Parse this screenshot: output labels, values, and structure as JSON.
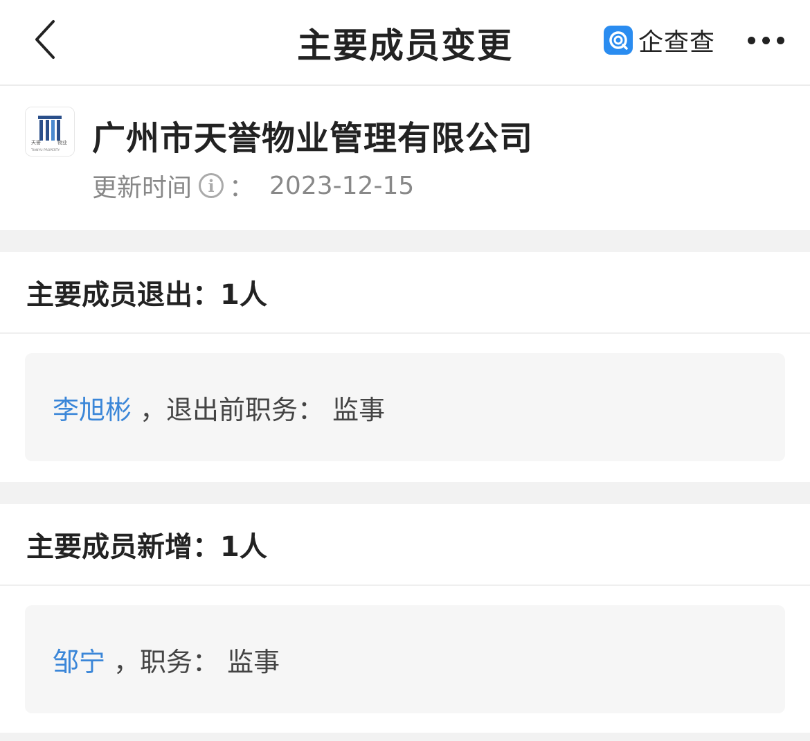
{
  "header": {
    "title": "主要成员变更",
    "brand": "企查查"
  },
  "company": {
    "name": "广州市天誉物业管理有限公司",
    "logo_text_cn_left": "天誉",
    "logo_text_cn_right": "物业",
    "logo_text_en": "TIANYU PROPERTY",
    "update_label": "更新时间",
    "update_sep": "：",
    "update_date": "2023-12-15"
  },
  "exit_section": {
    "title": "主要成员退出：1人",
    "records": [
      {
        "name": "李旭彬",
        "detail": "，退出前职务：  监事"
      }
    ]
  },
  "add_section": {
    "title": "主要成员新增：1人",
    "records": [
      {
        "name": "邹宁",
        "detail": "，职务：  监事"
      }
    ]
  },
  "colors": {
    "link": "#3a86d8",
    "brand": "#2a8cf0"
  }
}
